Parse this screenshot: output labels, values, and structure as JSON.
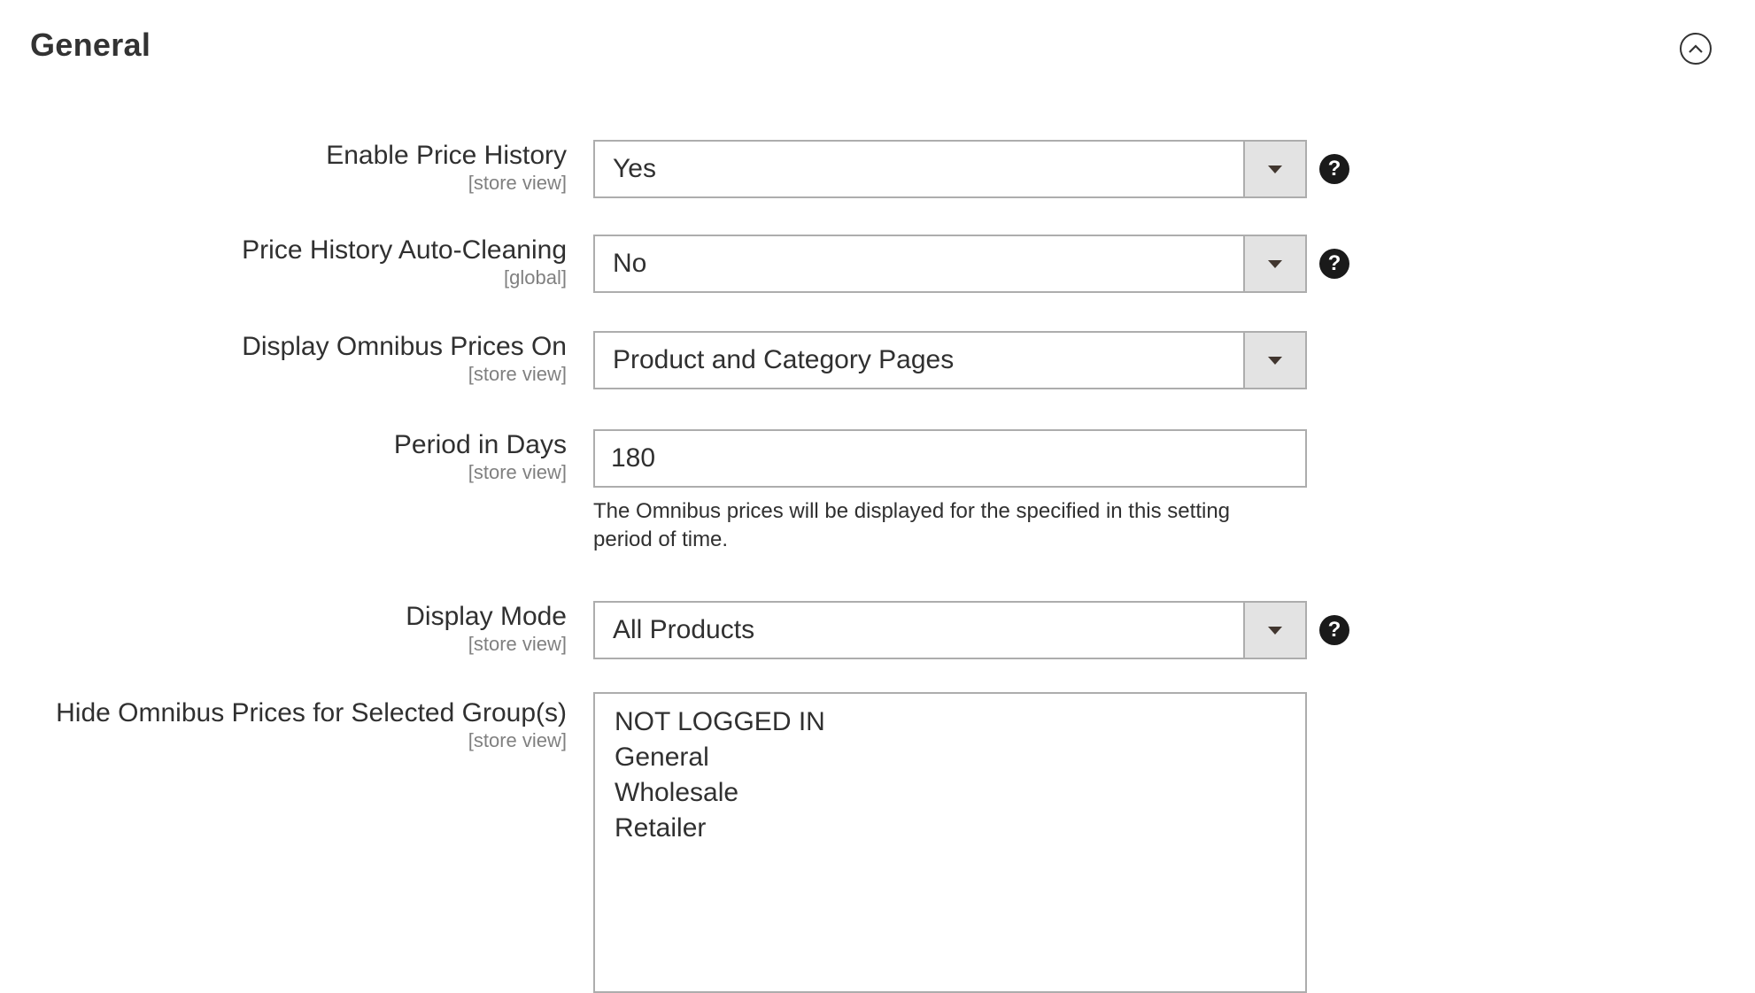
{
  "section": {
    "title": "General"
  },
  "fields": {
    "enable_price_history": {
      "label": "Enable Price History",
      "scope": "[store view]",
      "value": "Yes"
    },
    "auto_cleaning": {
      "label": "Price History Auto-Cleaning",
      "scope": "[global]",
      "value": "No"
    },
    "display_on": {
      "label": "Display Omnibus Prices On",
      "scope": "[store view]",
      "value": "Product and Category Pages"
    },
    "period": {
      "label": "Period in Days",
      "scope": "[store view]",
      "value": "180",
      "note": "The Omnibus prices will be displayed for the specified in this setting period of time."
    },
    "display_mode": {
      "label": "Display Mode",
      "scope": "[store view]",
      "value": "All Products"
    },
    "hide_groups": {
      "label": "Hide Omnibus Prices for Selected Group(s)",
      "scope": "[store view]",
      "options": [
        "NOT LOGGED IN",
        "General",
        "Wholesale",
        "Retailer"
      ]
    }
  },
  "help_symbol": "?",
  "icons": {
    "collapse": "chevron-up-circle-icon",
    "help": "question-circle-icon",
    "dropdown": "caret-down-icon"
  },
  "colors": {
    "border": "#adadad",
    "arrow_bg": "#e3e3e3",
    "help_bg": "#1a1a1a",
    "text": "#303030",
    "scope_text": "#808080"
  }
}
